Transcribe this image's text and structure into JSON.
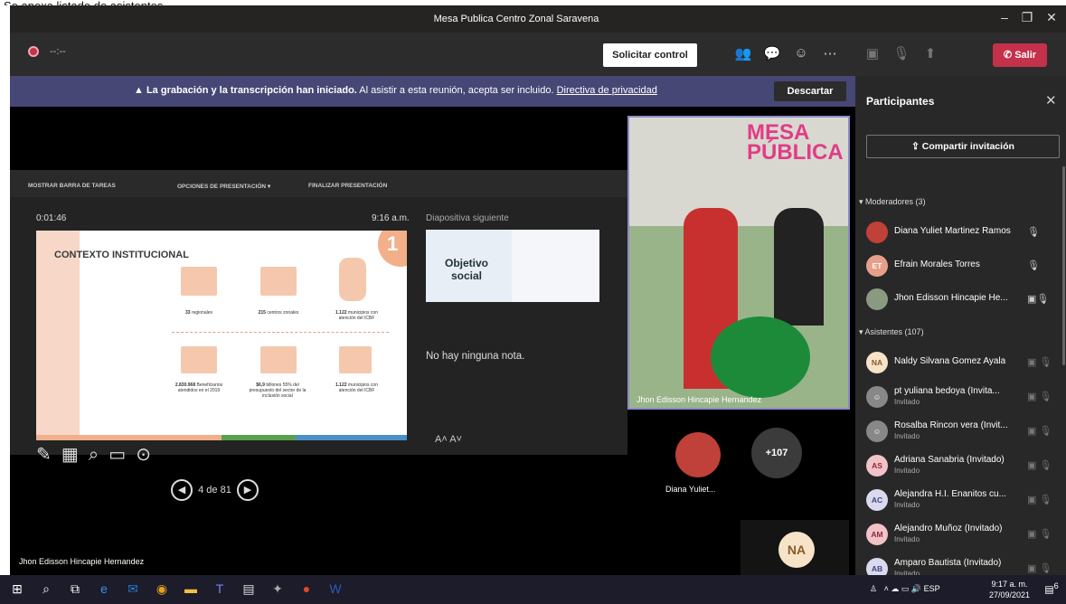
{
  "doc_note": "Se anexa listado de asistentes.",
  "window": {
    "title": "Mesa Publica Centro Zonal Saravena",
    "min": "–",
    "max": "❐",
    "close": "✕"
  },
  "toolbar": {
    "rec_time": "--:--",
    "request_control": "Solicitar control",
    "leave": "Salir"
  },
  "banner": {
    "bold": "La grabación y la transcripción han iniciado.",
    "text": "Al asistir a esta reunión, acepta ser incluido.",
    "link": "Directiva de privacidad",
    "dismiss": "Descartar"
  },
  "presenter": {
    "topbar": [
      "MOSTRAR BARRA DE TAREAS",
      "OPCIONES DE PRESENTACIÓN ▾",
      "FINALIZAR PRESENTACIÓN"
    ],
    "timer": "0:01:46",
    "clock": "9:16 a.m.",
    "next_label": "Diapositiva siguiente",
    "no_notes": "No hay ninguna nota.",
    "page": "4 de 81",
    "slide": {
      "title": "CONTEXTO INSTITUCIONAL",
      "number": "1",
      "stats": [
        {
          "value": "33",
          "label": "regionales"
        },
        {
          "value": "215",
          "label": "centros zonales"
        },
        {
          "value": "1.122",
          "label": "municipios con atención del ICBF"
        },
        {
          "value": "2.830.968",
          "label": "Beneficiarios atendidos en el 2019"
        },
        {
          "value": "$6,9",
          "label": "billones 55% del presupuesto del sector de la inclusión social"
        },
        {
          "value": "1.122",
          "label": "municipios con atención del ICBF"
        }
      ]
    },
    "next_slide": {
      "title": "Objetivo social"
    }
  },
  "video": {
    "name": "Jhon Edisson Hincapie Hernandez",
    "sign": "MESA PÚBLICA"
  },
  "stage": {
    "presenter_name": "Jhon Edisson Hincapie Hernandez",
    "diana_label": "Diana Yuliet...",
    "more_count": "+107",
    "na": "NA"
  },
  "panel": {
    "title": "Participantes",
    "share": "Compartir invitación",
    "moderators_label": "Moderadores (3)",
    "attendees_label": "Asistentes (107)",
    "moderators": [
      {
        "initials": "",
        "name": "Diana Yuliet Martinez Ramos",
        "color": "#c0403a"
      },
      {
        "initials": "ET",
        "name": "Efrain Morales Torres",
        "color": "#e6a08a"
      },
      {
        "initials": "",
        "name": "Jhon Edisson Hincapie He...",
        "color": "#8a9a80"
      }
    ],
    "attendees": [
      {
        "initials": "NA",
        "name": "Naldy Silvana Gomez Ayala",
        "role": "",
        "color": "#f7e3c8",
        "fg": "#8a5a2a"
      },
      {
        "initials": "",
        "name": "pt yuliana bedoya (Invita...",
        "role": "Invitado",
        "color": "#888",
        "fg": "#fff"
      },
      {
        "initials": "",
        "name": "Rosalba Rincon vera (Invit...",
        "role": "Invitado",
        "color": "#888",
        "fg": "#fff"
      },
      {
        "initials": "AS",
        "name": "Adriana Sanabria (Invitado)",
        "role": "Invitado",
        "color": "#f1c3c9",
        "fg": "#8a2a3a"
      },
      {
        "initials": "AC",
        "name": "Alejandra H.I. Enanitos cu...",
        "role": "Invitado",
        "color": "#d9d9ef",
        "fg": "#444477"
      },
      {
        "initials": "AM",
        "name": "Alejandro Muñoz (Invitado)",
        "role": "Invitado",
        "color": "#f1c3c9",
        "fg": "#8a2a3a"
      },
      {
        "initials": "AB",
        "name": "Amparo Bautista (Invitado)",
        "role": "Invitado",
        "color": "#d9d9ef",
        "fg": "#444477"
      }
    ]
  },
  "taskbar": {
    "lang": "ESP",
    "time": "9:17 a. m.",
    "date": "27/09/2021",
    "badge": "6"
  }
}
